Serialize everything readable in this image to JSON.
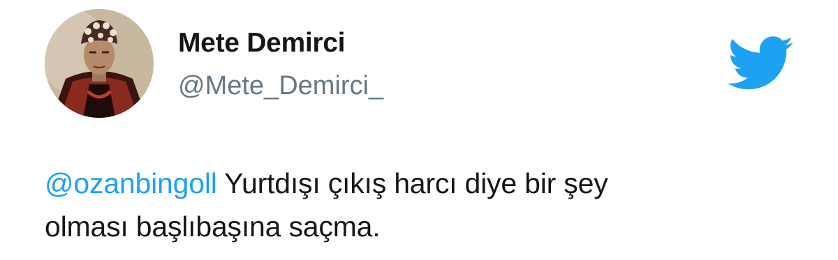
{
  "tweet": {
    "author": {
      "display_name": "Mete Demirci",
      "handle": "@Mete_Demirci_",
      "avatar_icon": "profile-photo"
    },
    "brand_icon": "twitter-bird-icon",
    "text": {
      "mention": "@ozanbingoll",
      "line1": " Yurtdışı çıkış harcı diye bir şey",
      "line2": "olması başlıbaşına saçma."
    }
  },
  "colors": {
    "twitter_blue": "#1da1f2",
    "text_primary": "#14171a",
    "text_secondary": "#657786"
  }
}
